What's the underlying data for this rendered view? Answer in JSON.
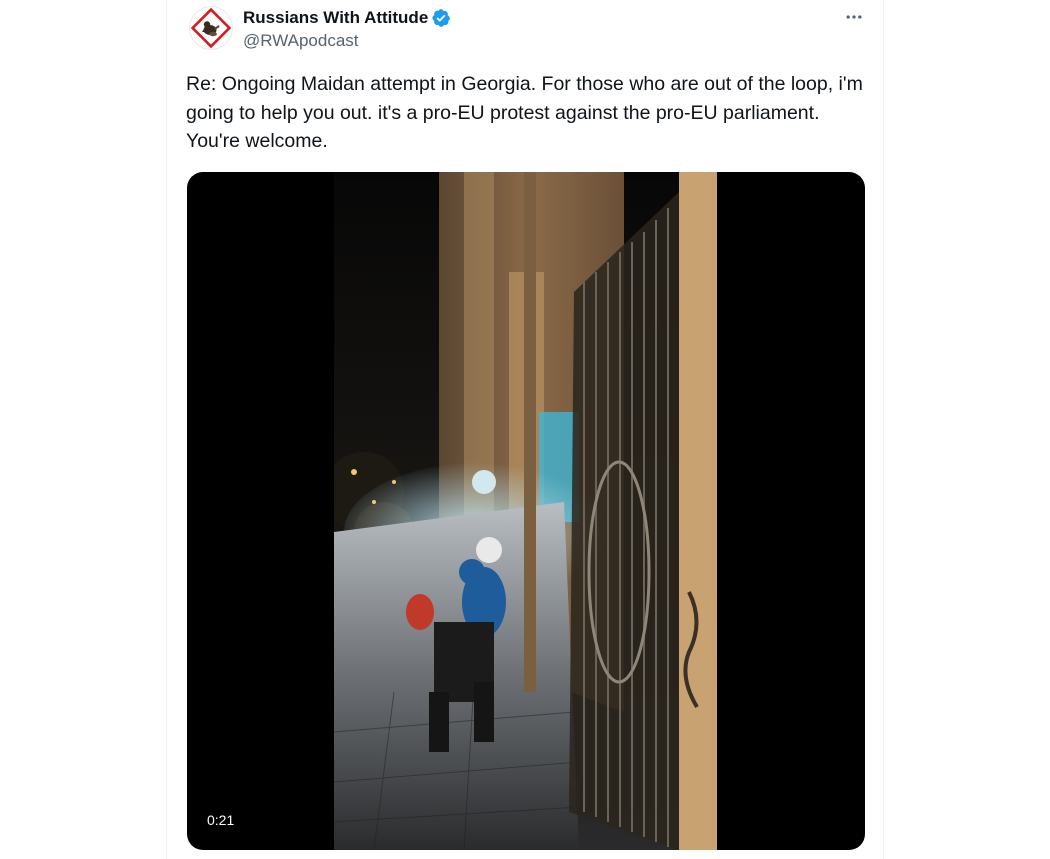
{
  "tweet": {
    "author": {
      "display_name": "Russians With Attitude",
      "handle": "@RWApodcast",
      "verified": true,
      "verified_badge_color": "#1d9bf0",
      "avatar_icon": "rwa-logo-icon"
    },
    "more_options_icon": "more-horizontal-icon",
    "text": "Re: Ongoing Maidan attempt in Georgia. For those who are out of the loop, i'm going to help you out. it's a pro-EU protest against the pro-EU parliament. You're welcome.",
    "media": {
      "type": "video",
      "duration": "0:21"
    }
  },
  "colors": {
    "text_primary": "#0f1419",
    "text_secondary": "#536471",
    "border": "#eff3f4",
    "accent_blue": "#1d9bf0",
    "media_background": "#000000"
  }
}
